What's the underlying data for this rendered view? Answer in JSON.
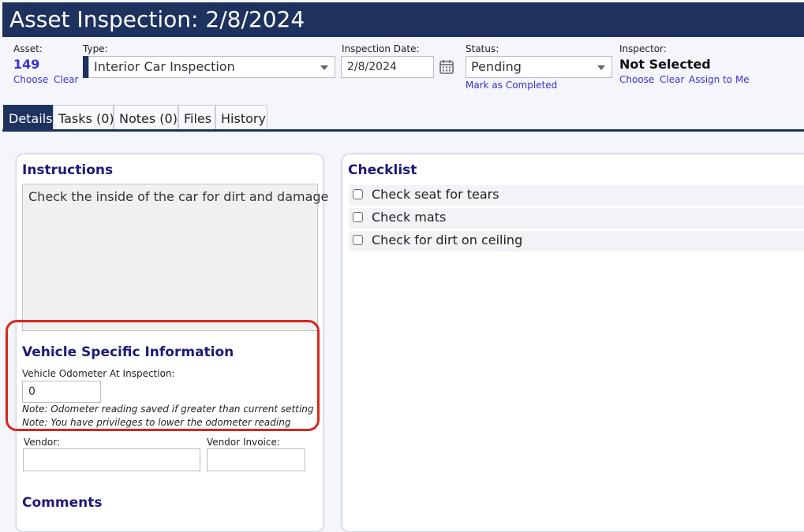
{
  "header": {
    "title": "Asset Inspection: 2/8/2024"
  },
  "asset": {
    "label": "Asset:",
    "value": "149",
    "choose": "Choose",
    "clear": "Clear"
  },
  "type": {
    "label": "Type:",
    "value": "Interior Car Inspection"
  },
  "inspection_date": {
    "label": "Inspection Date:",
    "value": "2/8/2024"
  },
  "status": {
    "label": "Status:",
    "value": "Pending",
    "mark_completed": "Mark as Completed"
  },
  "inspector": {
    "label": "Inspector:",
    "value": "Not Selected",
    "choose": "Choose",
    "clear": "Clear",
    "assign_to_me": "Assign to Me"
  },
  "tabs": [
    {
      "label": "Details"
    },
    {
      "label": "Tasks (0)"
    },
    {
      "label": "Notes (0)"
    },
    {
      "label": "Files"
    },
    {
      "label": "History"
    }
  ],
  "instructions": {
    "heading": "Instructions",
    "text": "Check the inside of the car for dirt and damage"
  },
  "vehicle": {
    "heading": "Vehicle Specific Information",
    "odometer_label": "Vehicle Odometer At Inspection:",
    "odometer_value": "0",
    "note1": "Note: Odometer reading saved if greater than current setting",
    "note2": "Note: You have privileges to lower the odometer reading"
  },
  "vendor": {
    "label": "Vendor:",
    "value": ""
  },
  "vendor_invoice": {
    "label": "Vendor Invoice:",
    "value": ""
  },
  "comments": {
    "heading": "Comments"
  },
  "checklist": {
    "heading": "Checklist",
    "items": [
      {
        "label": "Check seat for tears"
      },
      {
        "label": "Check mats"
      },
      {
        "label": "Check for dirt on ceiling"
      }
    ]
  },
  "colors": {
    "header_bg": "#1e3260",
    "link": "#3b2fd6",
    "heading": "#1d1a78",
    "highlight": "#d9261c"
  },
  "icons": {
    "date_picker": "calendar-icon",
    "dropdown": "chevron-down-icon",
    "checkbox": "checkbox-unchecked"
  }
}
